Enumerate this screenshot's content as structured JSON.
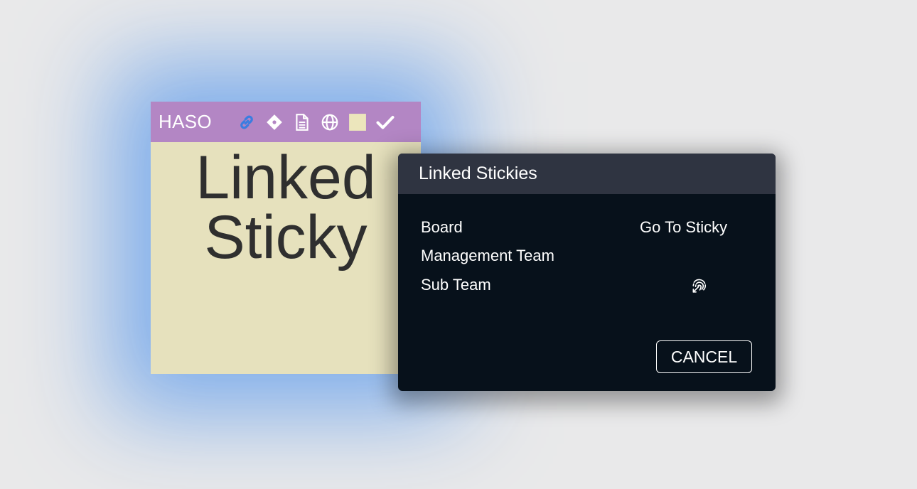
{
  "sticky": {
    "author": "HASO",
    "text_lines": [
      "Linked",
      "Sticky"
    ],
    "colors": {
      "header": "#b386c4",
      "body": "#e6e1bd",
      "glow": "#78aaeb",
      "link_icon": "#3b7de0"
    },
    "toolbar_icons": [
      "link-icon",
      "diamond-icon",
      "document-icon",
      "globe-icon",
      "color-swatch-icon",
      "check-icon"
    ]
  },
  "dialog": {
    "title": "Linked Stickies",
    "column_header": "Go To Sticky",
    "rows": [
      "Board",
      "Management Team",
      "Sub Team"
    ],
    "go_to_icon": "fingerprint-icon",
    "cancel_label": "CANCEL",
    "colors": {
      "title_bar": "#2f3441",
      "background": "#07111b"
    }
  }
}
